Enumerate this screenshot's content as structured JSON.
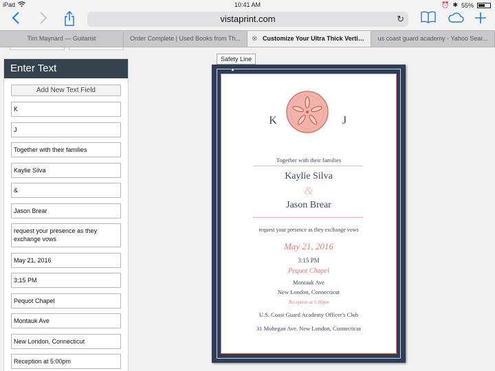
{
  "status_bar": {
    "carrier": "iPad",
    "time": "10:41 AM",
    "battery": "55%"
  },
  "browser": {
    "url": "vistaprint.com",
    "tabs": [
      {
        "label": "Tim Maynard — Guitarist"
      },
      {
        "label": "Order Complete | Used Books from Th..."
      },
      {
        "label": "Customize Your Ultra Thick Vertical..."
      },
      {
        "label": "us coast guard academy - Yahoo Sear..."
      }
    ]
  },
  "sidebar": {
    "title": "Enter Text",
    "add_button": "Add New Text Field",
    "fields": [
      {
        "value": "K"
      },
      {
        "value": "J"
      },
      {
        "value": "Together with their families"
      },
      {
        "value": "Kaylie Silva"
      },
      {
        "value": "&"
      },
      {
        "value": "Jason Brear"
      },
      {
        "value": "request your presence as they exchange vows"
      },
      {
        "value": "May 21, 2016"
      },
      {
        "value": "3:15 PM"
      },
      {
        "value": "Pequot Chapel"
      },
      {
        "value": "Montauk Ave"
      },
      {
        "value": "New London, Connecticut"
      },
      {
        "value": "Reception at 5:00pm"
      }
    ]
  },
  "preview": {
    "safety_line": "Safety Line",
    "initial_left": "K",
    "initial_right": "J",
    "together": "Together with their families",
    "name1": "Kaylie Silva",
    "ampersand": "&",
    "name2": "Jason Brear",
    "request": "request your presence as they exchange vows",
    "date": "May 21, 2016",
    "time": "3:15 PM",
    "venue": "Pequot Chapel",
    "street": "Montauk Ave",
    "city": "New London, Connecticut",
    "reception": "Reception at 5:00pm",
    "club": "U.S. Coast Guard Academy Officer's Club",
    "club_address": "31 Mohegan Ave. New London, Connecticut"
  },
  "colors": {
    "accent": "#1b7cf2",
    "header": "#35434f",
    "card_navy": "#2f3d56",
    "coral": "#e07a7a"
  }
}
